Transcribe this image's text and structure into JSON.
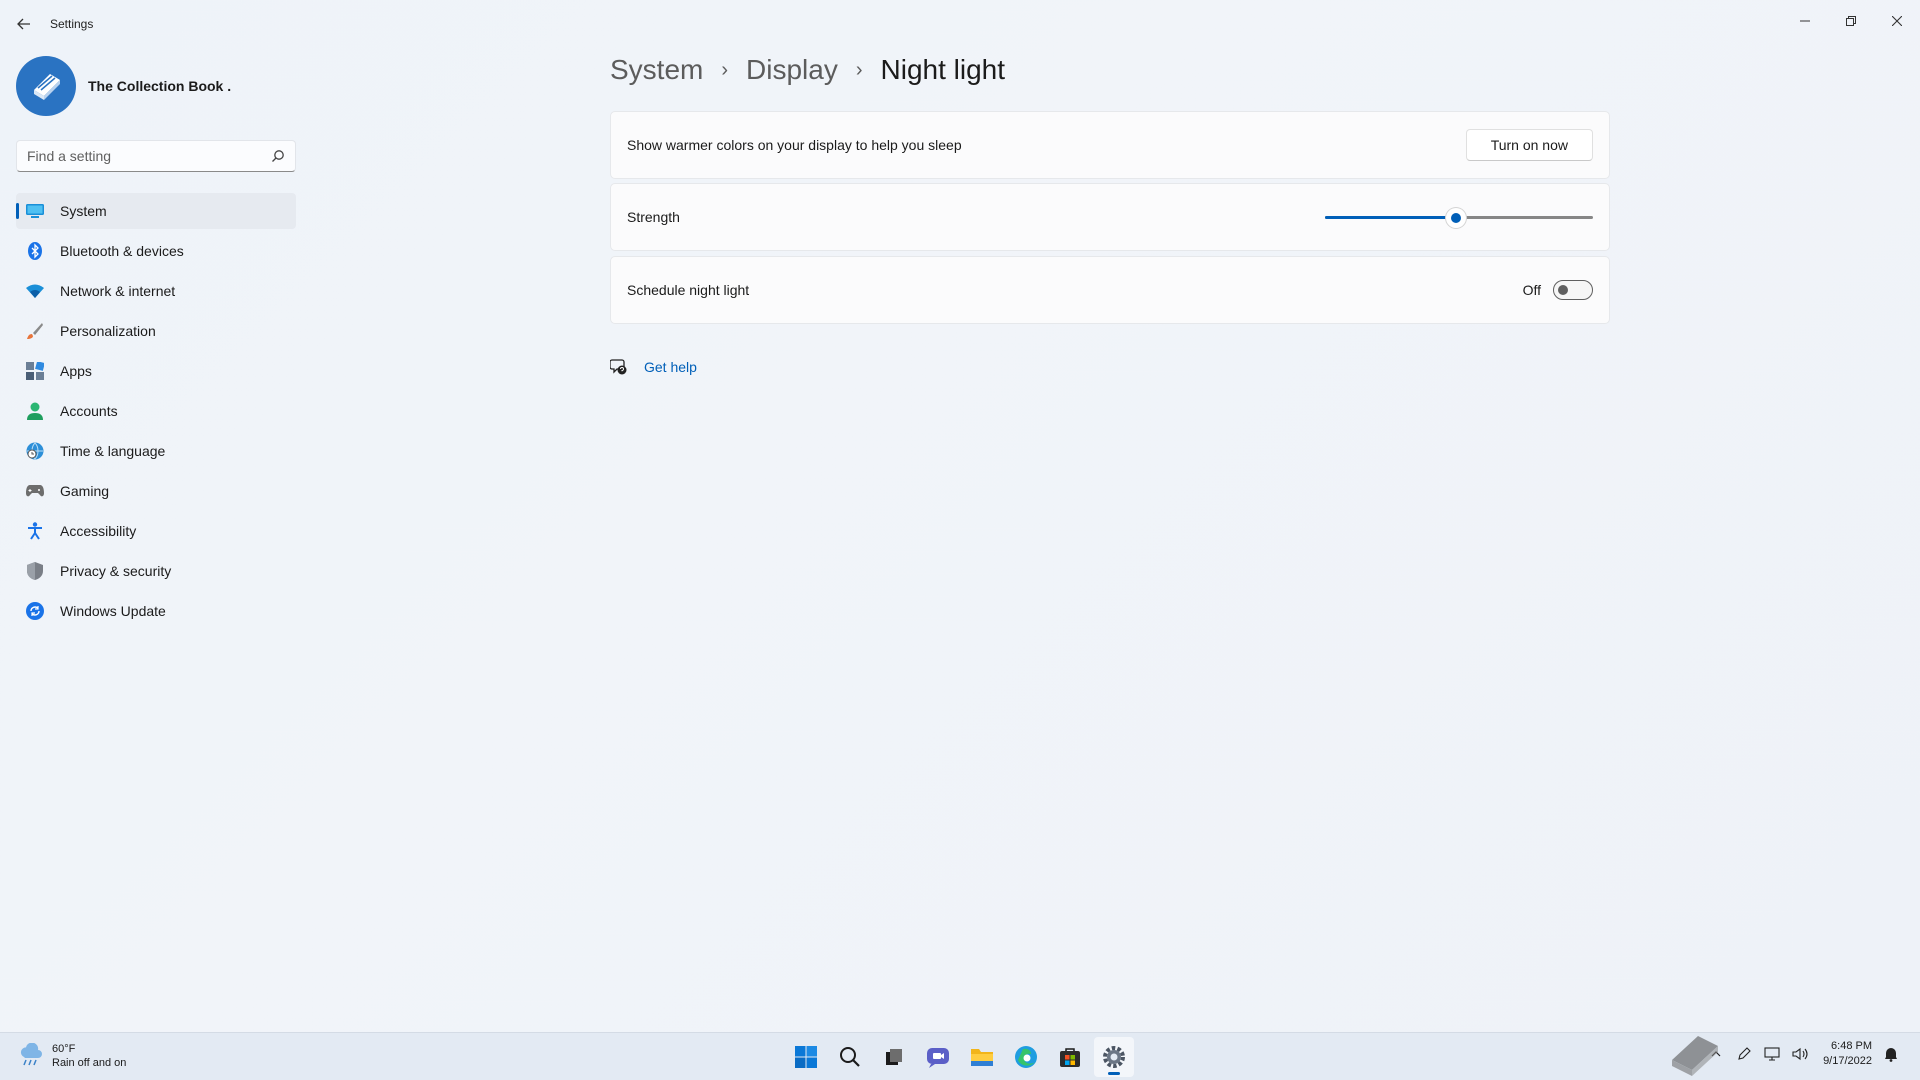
{
  "window": {
    "title": "Settings",
    "back_icon": "back-arrow-icon",
    "controls": [
      "minimize-icon",
      "restore-icon",
      "close-icon"
    ]
  },
  "profile": {
    "name": "The Collection Book ."
  },
  "search": {
    "placeholder": "Find a setting",
    "value": ""
  },
  "sidebar": {
    "items": [
      {
        "label": "System",
        "icon": "system-icon",
        "active": true
      },
      {
        "label": "Bluetooth & devices",
        "icon": "bluetooth-icon"
      },
      {
        "label": "Network & internet",
        "icon": "wifi-icon"
      },
      {
        "label": "Personalization",
        "icon": "brush-icon"
      },
      {
        "label": "Apps",
        "icon": "apps-icon"
      },
      {
        "label": "Accounts",
        "icon": "accounts-icon"
      },
      {
        "label": "Time & language",
        "icon": "globe-clock-icon"
      },
      {
        "label": "Gaming",
        "icon": "gamepad-icon"
      },
      {
        "label": "Accessibility",
        "icon": "accessibility-icon"
      },
      {
        "label": "Privacy & security",
        "icon": "shield-icon"
      },
      {
        "label": "Windows Update",
        "icon": "update-icon"
      }
    ]
  },
  "breadcrumb": {
    "items": [
      "System",
      "Display"
    ],
    "current": "Night light"
  },
  "settings": {
    "turn_on": {
      "label": "Show warmer colors on your display to help you sleep",
      "button": "Turn on now"
    },
    "strength": {
      "label": "Strength",
      "value_fraction": 0.49
    },
    "schedule": {
      "label": "Schedule night light",
      "state": "Off",
      "on": false
    }
  },
  "help": {
    "label": "Get help",
    "icon": "help-icon"
  },
  "taskbar": {
    "weather": {
      "temp": "60°F",
      "condition": "Rain off and on"
    },
    "apps": [
      "windows-start-icon",
      "search-icon",
      "task-view-icon",
      "chat-icon",
      "file-explorer-icon",
      "edge-icon",
      "store-icon",
      "settings-icon"
    ],
    "clock": {
      "time": "6:48 PM",
      "date": "9/17/2022"
    }
  },
  "colors": {
    "accent": "#005fb8",
    "background": "#eef2f8"
  }
}
